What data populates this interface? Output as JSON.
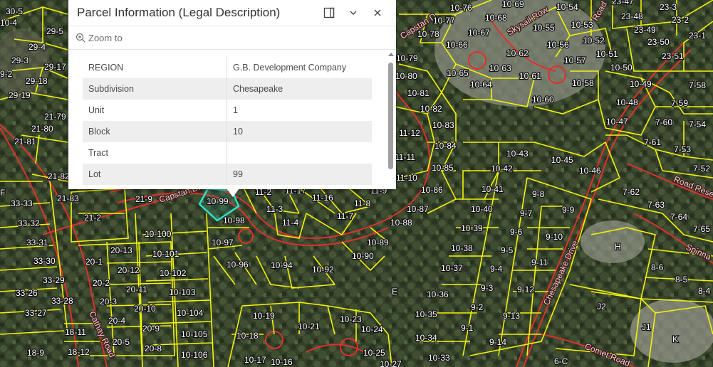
{
  "popup": {
    "title": "Parcel Information (Legal Description)",
    "zoom_label": "Zoom to",
    "rows": [
      {
        "key": "REGION",
        "value": "G.B. Development Company"
      },
      {
        "key": "Subdivision",
        "value": "Chesapeake"
      },
      {
        "key": "Unit",
        "value": "1"
      },
      {
        "key": "Block",
        "value": "10"
      },
      {
        "key": "Tract",
        "value": ""
      },
      {
        "key": "Lot",
        "value": "99"
      }
    ]
  },
  "roads": {
    "capstan": "Capstan Dr",
    "capstan2": "Capstan D",
    "skysail": "Skysail Row",
    "road": "Road",
    "chesapeake": "Chesapeake Drive",
    "comet": "Comet Road",
    "cathay": "Cathay Road",
    "spinna": "Spinna",
    "roadres": "Road Rese"
  },
  "parcels": [
    "30-5",
    "29-5",
    "29-4",
    "29-3",
    "29-17",
    "29-18",
    "29-19",
    "21-79",
    "21-80",
    "21-81",
    "21-83",
    "21-82",
    "21-9",
    "21-2",
    "20-13",
    "20-12",
    "20-11",
    "20-10",
    "20-9",
    "20-8",
    "20-4",
    "20-3",
    "20-2",
    "20-1",
    "20-5",
    "33-33",
    "33-32",
    "33-31",
    "33-30",
    "33-29",
    "33-28",
    "33-27",
    "33-26",
    "18-11",
    "18-12",
    "18-9",
    "10-100",
    "10-101",
    "10-102",
    "10-103",
    "10-104",
    "10-105",
    "10-106",
    "10-99",
    "10-98",
    "10-97",
    "10-96",
    "10-94",
    "10-92",
    "10-90",
    "10-89",
    "10-88",
    "10-87",
    "10-86",
    "10-85",
    "10-84",
    "10-83",
    "10-82",
    "10-81",
    "10-80",
    "10-79",
    "11-2",
    "11-3",
    "11-4",
    "11-17",
    "11-16",
    "11-7",
    "11-8",
    "11-9",
    "11-11",
    "11-12",
    "11-10",
    "10-76",
    "10-77",
    "10-78",
    "10-66",
    "10-67",
    "10-68",
    "10-69",
    "10-65",
    "10-64",
    "10-63",
    "10-62",
    "10-61",
    "10-60",
    "10-55",
    "10-56",
    "10-53",
    "10-54",
    "10-52",
    "10-51",
    "10-50",
    "10-57",
    "10-58",
    "10-49",
    "10-48",
    "10-47",
    "10-46",
    "10-45",
    "10-43",
    "10-42",
    "10-41",
    "10-40",
    "10-39",
    "10-38",
    "10-37",
    "10-36",
    "10-35",
    "10-34",
    "10-33",
    "10-19",
    "10-21",
    "10-23",
    "10-24",
    "10-25",
    "10-18",
    "10-17",
    "10-16",
    "9-8",
    "9-7",
    "9-9",
    "9-6",
    "9-10",
    "9-5",
    "9-11",
    "9-4",
    "9-3",
    "9-12",
    "9-2",
    "9-13",
    "9-1",
    "9-14",
    "23-47",
    "23-48",
    "23-49",
    "23-50",
    "23-51",
    "23-3",
    "23-2",
    "23-1",
    "7-58",
    "7-59",
    "7-60",
    "7-54",
    "7-61",
    "7-53",
    "7-52",
    "7-62",
    "7-63",
    "7-64",
    "7-65",
    "8-6",
    "8-5",
    "8-4",
    "H",
    "J1",
    "J2",
    "K",
    "E",
    "F",
    "6-C",
    "10-27",
    "10-4",
    "9-2"
  ]
}
